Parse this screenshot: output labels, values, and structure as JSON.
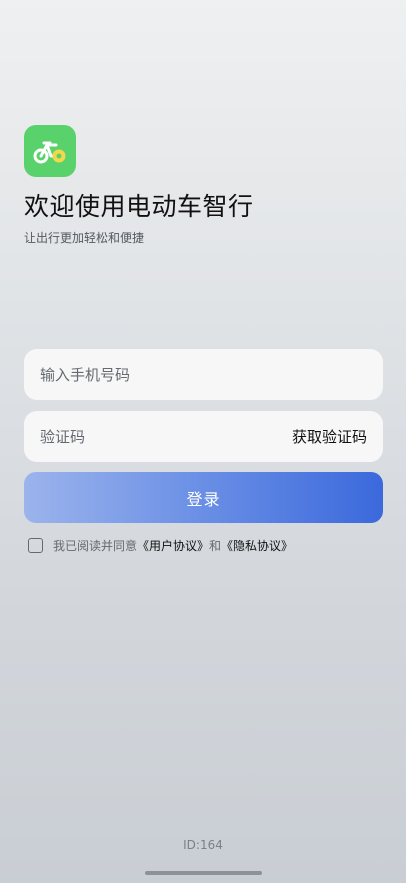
{
  "app": {
    "title": "欢迎使用电动车智行",
    "subtitle": "让出行更加轻松和便捷",
    "logo_icon": "bicycle-icon",
    "logo_color": "#5ad26b"
  },
  "form": {
    "phone_placeholder": "输入手机号码",
    "code_placeholder": "验证码",
    "get_code_label": "获取验证码",
    "login_label": "登录"
  },
  "agreement": {
    "checked": false,
    "prefix": "我已阅读并同意",
    "user_agreement": "《用户协议》",
    "and": "和",
    "privacy_policy": "《隐私协议》"
  },
  "footer": {
    "id_text": "ID:164"
  },
  "colors": {
    "button_start": "#9cb4ec",
    "button_end": "#3b69dc"
  }
}
